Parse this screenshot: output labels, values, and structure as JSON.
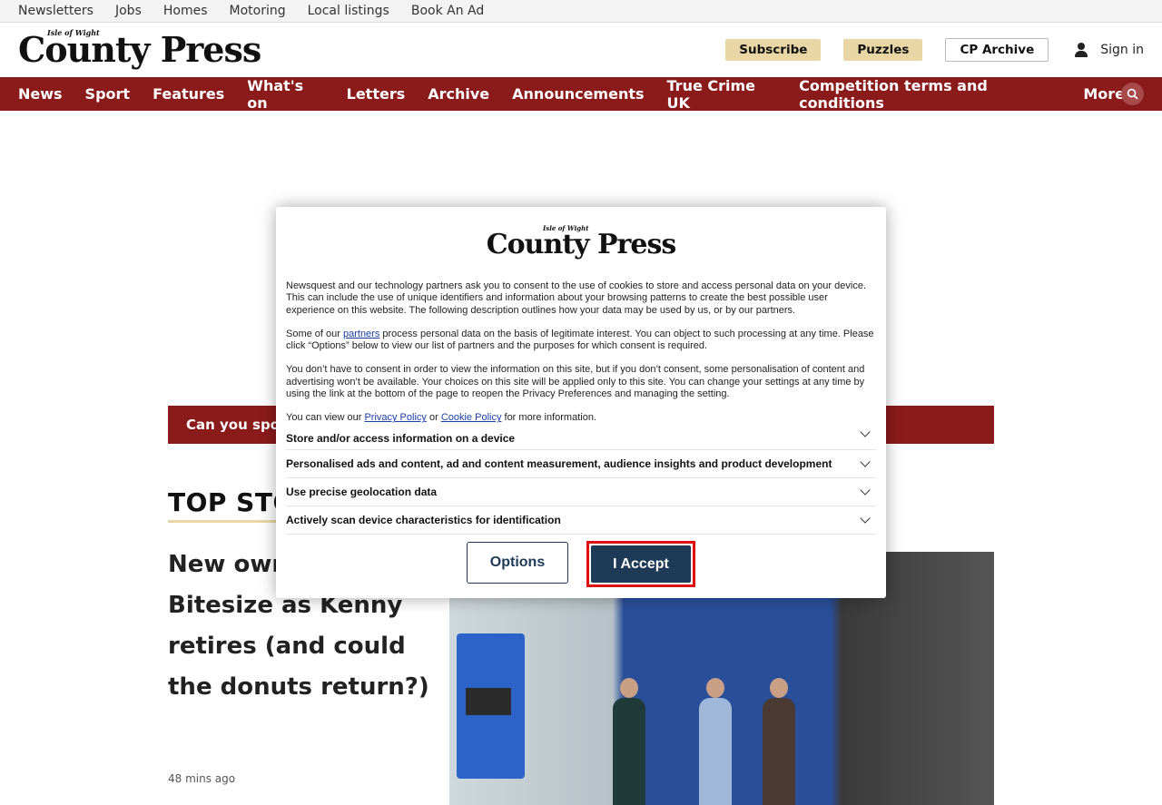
{
  "topbar": {
    "links": [
      "Newsletters",
      "Jobs",
      "Homes",
      "Motoring",
      "Local listings",
      "Book An Ad"
    ]
  },
  "masthead": {
    "logo_small": "Isle of Wight",
    "logo_text": "County Press",
    "subscribe": "Subscribe",
    "puzzles": "Puzzles",
    "archive": "CP Archive",
    "signin": "Sign in"
  },
  "nav": {
    "items": [
      "News",
      "Sport",
      "Features",
      "What's on",
      "Letters",
      "Archive",
      "Announcements",
      "True Crime UK",
      "Competition terms and conditions"
    ],
    "more": "More"
  },
  "ticker": {
    "text": "Can you spot"
  },
  "section": {
    "title": "TOP STO"
  },
  "story": {
    "headline": "New own takeaway Bitesize as Kenny retires (and could the donuts return?)",
    "time": "48 mins ago"
  },
  "consent": {
    "logo_small": "Isle of Wight",
    "logo_text": "County Press",
    "para1": "Newsquest and our technology partners ask you to consent to the use of cookies to store and access personal data on your device. This can include the use of unique identifiers and information about your browsing patterns to create the best possible user experience on this website. The following description outlines how your data may be used by us, or by our partners.",
    "para2_a": "Some of our ",
    "para2_link": "partners",
    "para2_b": " process personal data on the basis of legitimate interest. You can object to such processing at any time. Please click “Options” below to view our list of partners and the purposes for which consent is required.",
    "para3": "You don’t have to consent in order to view the information on this site, but if you don’t consent, some personalisation of content and advertising won’t be available. Your choices on this site will be applied only to this site. You can change your settings at any time by using the link at the bottom of the page to reopen the Privacy Preferences and managing the setting.",
    "para4_a": "You can view our ",
    "para4_link1": "Privacy Policy",
    "para4_mid": " or ",
    "para4_link2": "Cookie Policy",
    "para4_b": " for more information.",
    "purposes": [
      "Store and/or access information on a device",
      "Personalised ads and content, ad and content measurement, audience insights and product development",
      "Use precise geolocation data",
      "Actively scan device characteristics for identification"
    ],
    "options_label": "Options",
    "accept_label": "I Accept"
  },
  "colors": {
    "nav_bg": "#8b1a1a",
    "accent_gold": "#e8d7a4",
    "button_navy": "#1e3a56",
    "highlight_red": "#e01010"
  }
}
